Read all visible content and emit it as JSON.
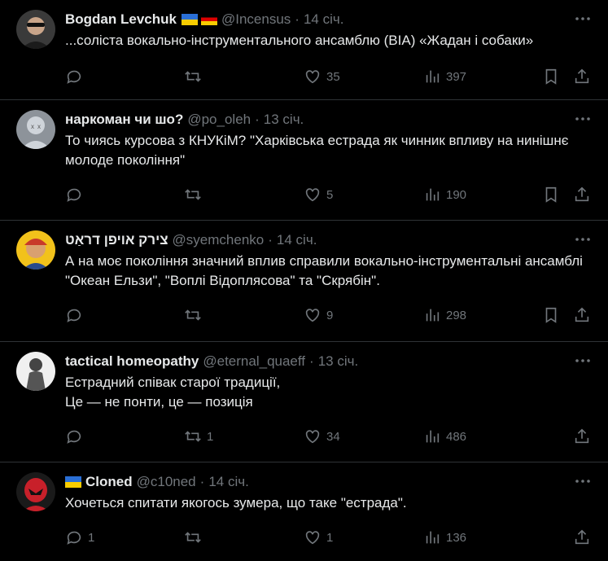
{
  "tweets": [
    {
      "name": "Bogdan Levchuk",
      "flags": [
        "ua",
        "de"
      ],
      "handle": "@Incensus",
      "time": "14 січ.",
      "text": "...соліста вокально-інструментального ансамблю (ВІА) «Жадан і собаки»",
      "replies": "",
      "retweets": "",
      "likes": "35",
      "views": "397"
    },
    {
      "name": "наркоман чи шо?",
      "flags": [],
      "handle": "@po_oleh",
      "time": "13 січ.",
      "text": "То чиясь курсова з КНУКіМ? \"Харківська естрада як чинник впливу на нинішнє молоде покоління\"",
      "replies": "",
      "retweets": "",
      "likes": "5",
      "views": "190"
    },
    {
      "name": "צירק אויפן דראַט",
      "flags": [],
      "handle": "@syemchenko",
      "time": "14 січ.",
      "text": "А на моє покоління значний вплив справили вокально-інструментальні ансамблі \"Океан Ельзи\", \"Воплі Відоплясова\" та \"Скрябін\".",
      "replies": "",
      "retweets": "",
      "likes": "9",
      "views": "298"
    },
    {
      "name": "tactical homeopathy",
      "flags": [],
      "handle": "@eternal_quaeff",
      "time": "13 січ.",
      "text": "Естрадний співак старої традиції,\nЦе — не понти, це — позиція",
      "replies": "",
      "retweets": "1",
      "likes": "34",
      "views": "486"
    },
    {
      "name": "Cloned",
      "flags": [
        "ua"
      ],
      "handle": "@c10ned",
      "time": "14 січ.",
      "text": "Хочеться спитати якогось зумера, що таке \"естрада\".",
      "replies": "1",
      "retweets": "",
      "likes": "1",
      "views": "136"
    }
  ],
  "dot": "·"
}
